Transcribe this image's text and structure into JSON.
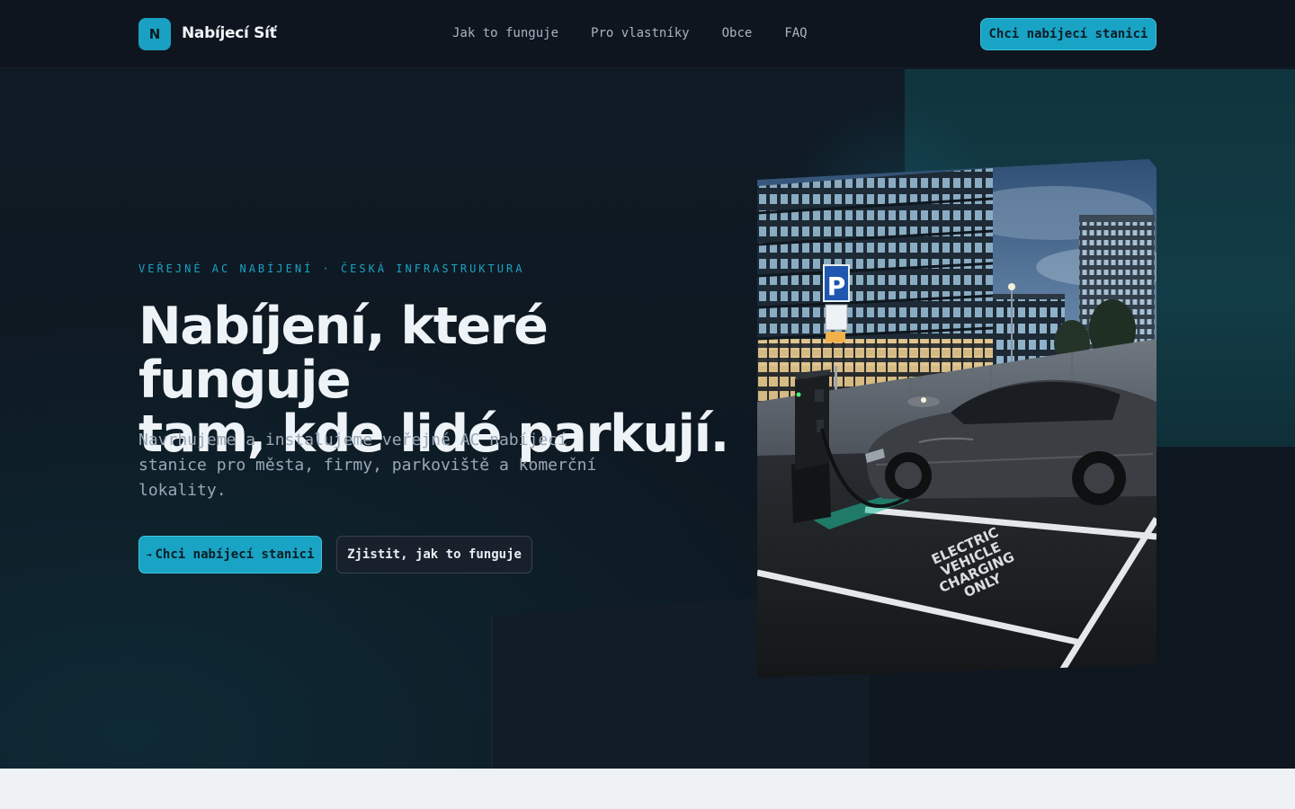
{
  "brand": {
    "badge": "N",
    "name": "Nabíjecí Síť",
    "accent": "#1aa3c5"
  },
  "nav": {
    "links": [
      "Jak to funguje",
      "Pro vlastníky",
      "Obce",
      "FAQ"
    ],
    "cta": "Chci nabíjecí stanici"
  },
  "hero": {
    "eyebrow": "VEŘEJNÉ AC NABÍJENÍ · ČESKÁ INFRASTRUKTURA",
    "headline_line1": "Nabíjení, které funguje",
    "headline_line2": "tam, kde lidé parkují.",
    "subtitle": "Navrhujeme a instalujeme veřejné AC nabíjecí stanice pro města, firmy, parkoviště a komerční lokality.",
    "primary_button": "Chci nabíjecí stanici",
    "primary_icon": "arrow-right-icon",
    "secondary_button": "Zjistit, jak to funguje"
  },
  "photo": {
    "parking_sign": "P",
    "ground_text": [
      "ELECTRIC",
      "VEHICLE",
      "CHARGING",
      "ONLY"
    ]
  }
}
